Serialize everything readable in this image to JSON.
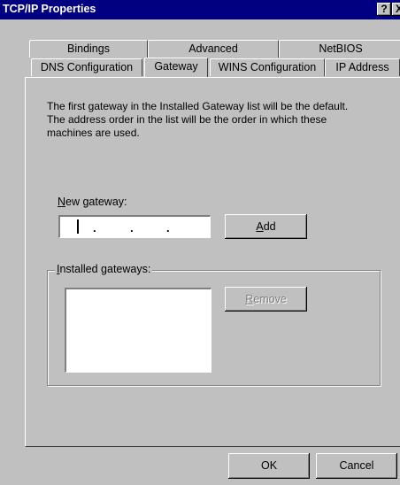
{
  "window": {
    "title": "TCP/IP Properties",
    "help_glyph": "?",
    "close_glyph": "X"
  },
  "tabs_back": [
    "Bindings",
    "Advanced",
    "NetBIOS"
  ],
  "tabs_front": [
    "DNS Configuration",
    "Gateway",
    "WINS Configuration",
    "IP Address"
  ],
  "active_tab": "Gateway",
  "description": [
    "The first gateway in the Installed Gateway list will be the default.",
    "The address order in the list will be the order in which these",
    "machines are used."
  ],
  "new_gateway": {
    "label_mnemonic": "N",
    "label_rest": "ew gateway:",
    "dot": "."
  },
  "add_button": {
    "mnemonic": "A",
    "rest": "dd"
  },
  "installed": {
    "label_mnemonic": "I",
    "label_rest": "nstalled gateways:",
    "items": []
  },
  "remove_button": {
    "mnemonic": "R",
    "rest": "emove",
    "disabled": true
  },
  "footer": {
    "ok": "OK",
    "cancel": "Cancel"
  }
}
